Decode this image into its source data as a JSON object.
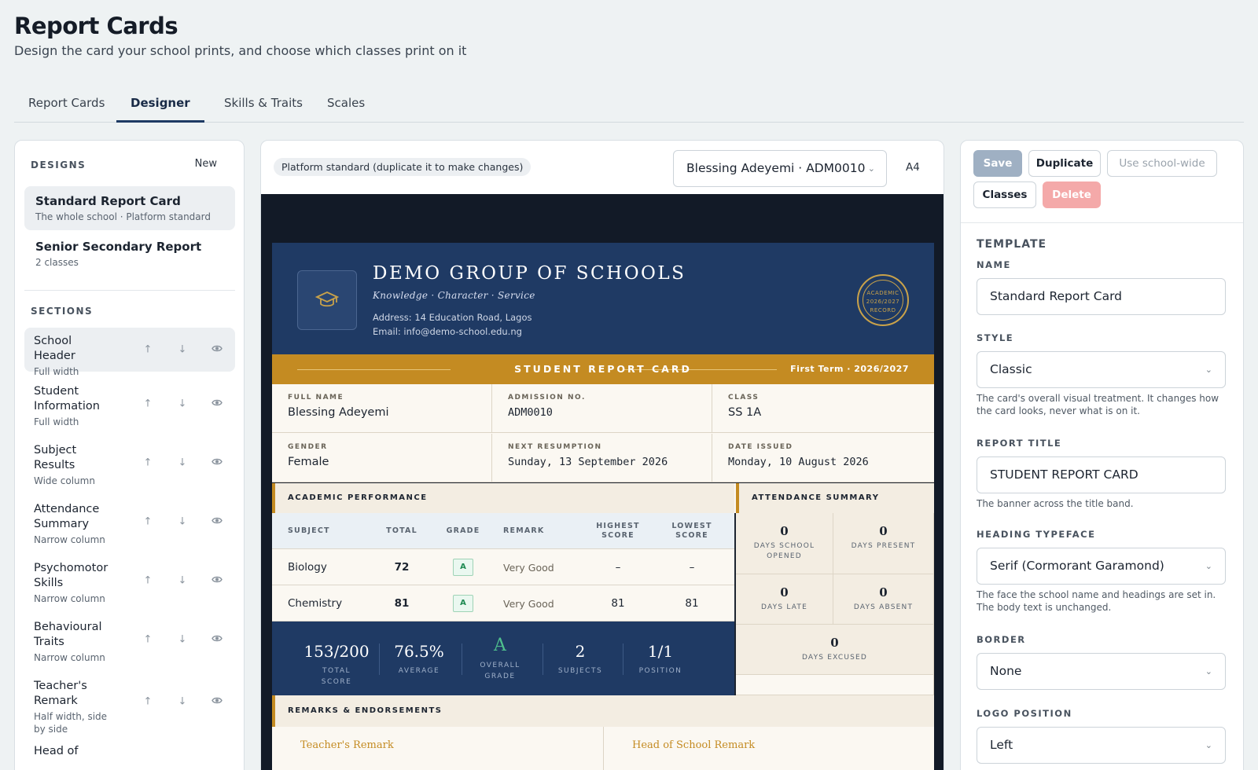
{
  "header": {
    "title": "Report Cards",
    "subtitle": "Design the card your school prints, and choose which classes print on it"
  },
  "tabs": [
    "Report Cards",
    "Designer",
    "Skills & Traits",
    "Scales"
  ],
  "sidebar": {
    "designs_heading": "DESIGNS",
    "new_label": "New",
    "designs": [
      {
        "title": "Standard Report Card",
        "sub": "The whole school · Platform standard"
      },
      {
        "title": "Senior Secondary Report",
        "sub": "2 classes"
      }
    ],
    "sections_heading": "SECTIONS",
    "sections": [
      {
        "title": "School Header",
        "sub": "Full width"
      },
      {
        "title": "Student Information",
        "sub": "Full width"
      },
      {
        "title": "Subject Results",
        "sub": "Wide column"
      },
      {
        "title": "Attendance Summary",
        "sub": "Narrow column"
      },
      {
        "title": "Psychomotor Skills",
        "sub": "Narrow column"
      },
      {
        "title": "Behavioural Traits",
        "sub": "Narrow column"
      },
      {
        "title": "Teacher's Remark",
        "sub": "Half width, side by side"
      },
      {
        "title": "Head of",
        "sub": ""
      }
    ]
  },
  "preview": {
    "badge": "Platform standard (duplicate it to make changes)",
    "student": "Blessing Adeyemi · ADM0010",
    "paper": "A4",
    "card": {
      "school_name": "DEMO GROUP OF SCHOOLS",
      "motto": "Knowledge · Character · Service",
      "address": "Address: 14 Education Road, Lagos",
      "email": "Email: info@demo-school.edu.ng",
      "seal": [
        "ACADEMIC",
        "2026/2027",
        "RECORD"
      ],
      "banner_title": "STUDENT REPORT CARD",
      "term": "First Term  ·  2026/2027",
      "info": [
        {
          "label": "FULL NAME",
          "value": "Blessing Adeyemi",
          "mono": false
        },
        {
          "label": "ADMISSION NO.",
          "value": "ADM0010",
          "mono": true
        },
        {
          "label": "CLASS",
          "value": "SS 1A",
          "mono": false
        },
        {
          "label": "GENDER",
          "value": "Female",
          "mono": false
        },
        {
          "label": "NEXT RESUMPTION",
          "value": "Sunday, 13 September 2026",
          "mono": true
        },
        {
          "label": "DATE ISSUED",
          "value": "Monday, 10 August 2026",
          "mono": true
        }
      ],
      "academic_heading": "ACADEMIC PERFORMANCE",
      "attendance_heading": "ATTENDANCE SUMMARY",
      "table_headers": [
        "SUBJECT",
        "TOTAL",
        "GRADE",
        "REMARK",
        "HIGHEST SCORE",
        "LOWEST SCORE"
      ],
      "rows": [
        {
          "subject": "Biology",
          "total": "72",
          "grade": "A",
          "remark": "Very Good",
          "highest": "–",
          "lowest": "–"
        },
        {
          "subject": "Chemistry",
          "total": "81",
          "grade": "A",
          "remark": "Very Good",
          "highest": "81",
          "lowest": "81"
        }
      ],
      "summary": [
        {
          "value": "153/200",
          "label": "TOTAL SCORE"
        },
        {
          "value": "76.5%",
          "label": "AVERAGE"
        },
        {
          "value": "A",
          "label": "OVERALL GRADE"
        },
        {
          "value": "2",
          "label": "SUBJECTS"
        },
        {
          "value": "1/1",
          "label": "POSITION"
        }
      ],
      "attendance": [
        {
          "value": "0",
          "label": "DAYS SCHOOL OPENED"
        },
        {
          "value": "0",
          "label": "DAYS PRESENT"
        },
        {
          "value": "0",
          "label": "DAYS LATE"
        },
        {
          "value": "0",
          "label": "DAYS ABSENT"
        },
        {
          "value": "0",
          "label": "DAYS EXCUSED"
        }
      ],
      "remarks_heading": "REMARKS & ENDORSEMENTS",
      "teacher_remark": "Teacher's Remark",
      "head_remark": "Head of School Remark"
    }
  },
  "actions": {
    "save": "Save",
    "duplicate": "Duplicate",
    "use_school_wide": "Use school-wide",
    "classes": "Classes",
    "delete": "Delete"
  },
  "template": {
    "heading": "TEMPLATE",
    "name_label": "NAME",
    "name_value": "Standard Report Card",
    "style_label": "STYLE",
    "style_value": "Classic",
    "style_help": "The card's overall visual treatment. It changes how the card looks, never what is on it.",
    "report_title_label": "REPORT TITLE",
    "report_title_value": "STUDENT REPORT CARD",
    "report_title_help": "The banner across the title band.",
    "heading_typeface_label": "HEADING TYPEFACE",
    "heading_typeface_value": "Serif (Cormorant Garamond)",
    "heading_typeface_help": "The face the school name and headings are set in. The body text is unchanged.",
    "border_label": "BORDER",
    "border_value": "None",
    "logo_position_label": "LOGO POSITION",
    "logo_position_value": "Left"
  },
  "colors": {
    "navy": "#1f3a64",
    "gold": "#c48b22",
    "grade_green": "#1f8a52"
  }
}
